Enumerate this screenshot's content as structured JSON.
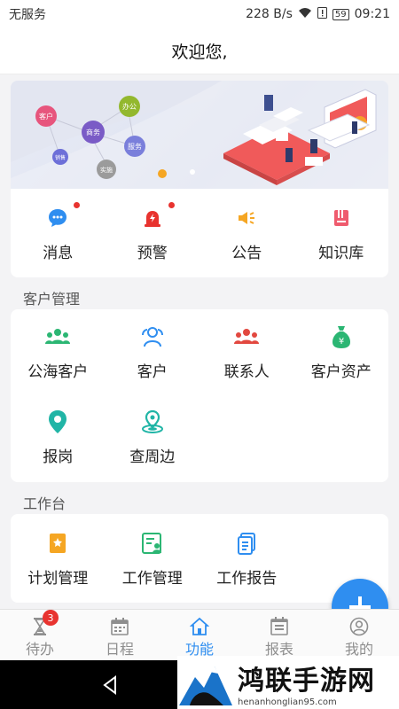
{
  "status_bar": {
    "carrier": "无服务",
    "network_speed": "228 B/s",
    "battery": "59",
    "time": "09:21"
  },
  "header": {
    "title": "欢迎您,"
  },
  "banner": {
    "nodes": [
      "客户",
      "商务",
      "办公",
      "服务",
      "销售",
      "实施"
    ],
    "page_count": 2,
    "active_page": 1
  },
  "quick_actions": [
    {
      "label": "消息",
      "icon": "message-icon",
      "has_dot": true
    },
    {
      "label": "预警",
      "icon": "alarm-icon",
      "has_dot": true
    },
    {
      "label": "公告",
      "icon": "megaphone-icon",
      "has_dot": false
    },
    {
      "label": "知识库",
      "icon": "book-icon",
      "has_dot": false
    }
  ],
  "customer_section": {
    "title": "客户管理",
    "items": [
      {
        "label": "公海客户",
        "icon": "group-icon"
      },
      {
        "label": "客户",
        "icon": "customer-icon"
      },
      {
        "label": "联系人",
        "icon": "contacts-icon"
      },
      {
        "label": "客户资产",
        "icon": "money-bag-icon"
      },
      {
        "label": "报岗",
        "icon": "location-pin-icon"
      },
      {
        "label": "查周边",
        "icon": "nearby-icon"
      }
    ]
  },
  "work_section": {
    "title": "工作台",
    "items": [
      {
        "label": "计划管理",
        "icon": "plan-icon"
      },
      {
        "label": "工作管理",
        "icon": "work-icon"
      },
      {
        "label": "工作报告",
        "icon": "report-icon"
      }
    ]
  },
  "tabbar": {
    "tabs": [
      {
        "label": "待办",
        "icon": "hourglass-icon",
        "badge": "3"
      },
      {
        "label": "日程",
        "icon": "calendar-icon"
      },
      {
        "label": "功能",
        "icon": "home-icon",
        "active": true
      },
      {
        "label": "报表",
        "icon": "report-chart-icon"
      },
      {
        "label": "我的",
        "icon": "user-icon"
      }
    ]
  },
  "watermark": {
    "text": "鸿联手游网",
    "url": "henanhonglian95.com"
  },
  "colors": {
    "accent": "#2f8ef0",
    "green": "#2bb673",
    "red": "#e8332f",
    "orange": "#f5a623",
    "teal": "#21b5a6"
  }
}
